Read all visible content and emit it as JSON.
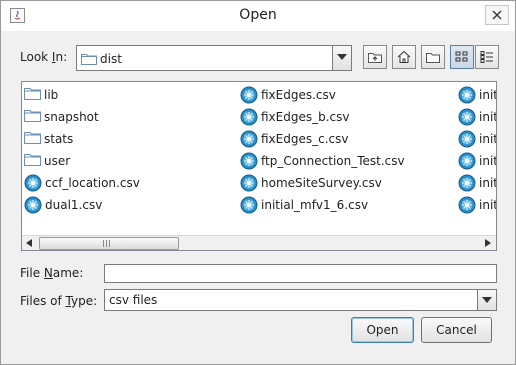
{
  "dialog": {
    "title": "Open"
  },
  "look_in": {
    "label_before": "Look ",
    "label_mnemonic": "I",
    "label_after": "n:",
    "value": "dist"
  },
  "toolbar": {
    "buttons": [
      {
        "name": "up-one-level",
        "icon": "folder-up-icon"
      },
      {
        "name": "home",
        "icon": "home-icon"
      },
      {
        "name": "create-new-folder",
        "icon": "new-folder-icon"
      },
      {
        "name": "list-view",
        "icon": "list-view-icon",
        "active": true
      },
      {
        "name": "details-view",
        "icon": "details-view-icon"
      }
    ]
  },
  "files": {
    "col1": [
      {
        "name": "lib",
        "type": "folder"
      },
      {
        "name": "snapshot",
        "type": "folder"
      },
      {
        "name": "stats",
        "type": "folder"
      },
      {
        "name": "user",
        "type": "folder"
      },
      {
        "name": "ccf_location.csv",
        "type": "file"
      },
      {
        "name": "dual1.csv",
        "type": "file"
      }
    ],
    "col2": [
      {
        "name": "fixEdges.csv",
        "type": "file"
      },
      {
        "name": "fixEdges_b.csv",
        "type": "file"
      },
      {
        "name": "fixEdges_c.csv",
        "type": "file"
      },
      {
        "name": "ftp_Connection_Test.csv",
        "type": "file"
      },
      {
        "name": "homeSiteSurvey.csv",
        "type": "file"
      },
      {
        "name": "initial_mfv1_6.csv",
        "type": "file"
      }
    ],
    "col3": [
      {
        "name": "init",
        "type": "file"
      },
      {
        "name": "init",
        "type": "file"
      },
      {
        "name": "init",
        "type": "file"
      },
      {
        "name": "init",
        "type": "file"
      },
      {
        "name": "init",
        "type": "file"
      },
      {
        "name": "init",
        "type": "file"
      }
    ]
  },
  "file_name": {
    "label_before": "File ",
    "label_mnemonic": "N",
    "label_after": "ame:",
    "value": ""
  },
  "files_of_type": {
    "label_before": "Files of ",
    "label_mnemonic": "T",
    "label_after": "ype:",
    "value": "csv files"
  },
  "buttons": {
    "open": "Open",
    "cancel": "Cancel"
  },
  "colors": {
    "default_button_border": "#3c7fb1",
    "list_border": "#828790",
    "file_icon": "#1f7fb4"
  }
}
